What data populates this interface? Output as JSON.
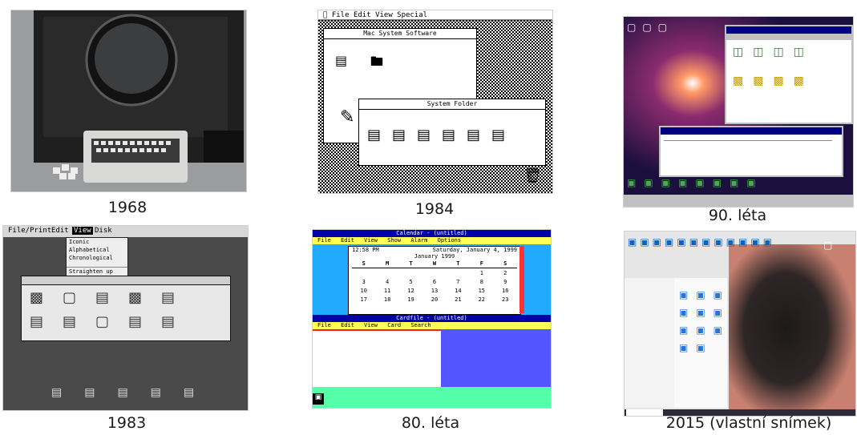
{
  "captions": {
    "c1968": "1968",
    "c1984": "1984",
    "c90": "90. léta",
    "c1983": "1983",
    "c80": "80. léta",
    "c2015": "2015 (vlastní snímek)"
  },
  "mac1984": {
    "menu": [
      "File",
      "Edit",
      "View",
      "Special"
    ],
    "window1_title": "Mac System Software",
    "window2_title": "System Folder"
  },
  "star1983": {
    "menu": [
      "File/Print",
      "Edit",
      "View",
      "Disk"
    ],
    "view_menu_items": [
      "Iconic",
      "Alphabetical",
      "Chronological",
      "Straighten up Icons"
    ]
  },
  "win1985": {
    "title": "Calendar - (untitled)",
    "menu": [
      "File",
      "Edit",
      "View",
      "Show",
      "Alarm",
      "Options"
    ],
    "time": "12:58 PM",
    "date": "Saturday, January 4, 1999",
    "month": "January 1999",
    "weekdays": [
      "S",
      "M",
      "T",
      "W",
      "T",
      "F",
      "S"
    ],
    "rows": [
      [
        "",
        "",
        "",
        "",
        "",
        "1",
        "2"
      ],
      [
        "3",
        "4",
        "5",
        "6",
        "7",
        "8",
        "9"
      ],
      [
        "10",
        "11",
        "12",
        "13",
        "14",
        "15",
        "16"
      ],
      [
        "17",
        "18",
        "19",
        "20",
        "21",
        "22",
        "23"
      ]
    ],
    "cardfile_title": "Cardfile - (untitled)",
    "cardfile_menu": [
      "File",
      "Edit",
      "View",
      "Card",
      "Search"
    ]
  }
}
